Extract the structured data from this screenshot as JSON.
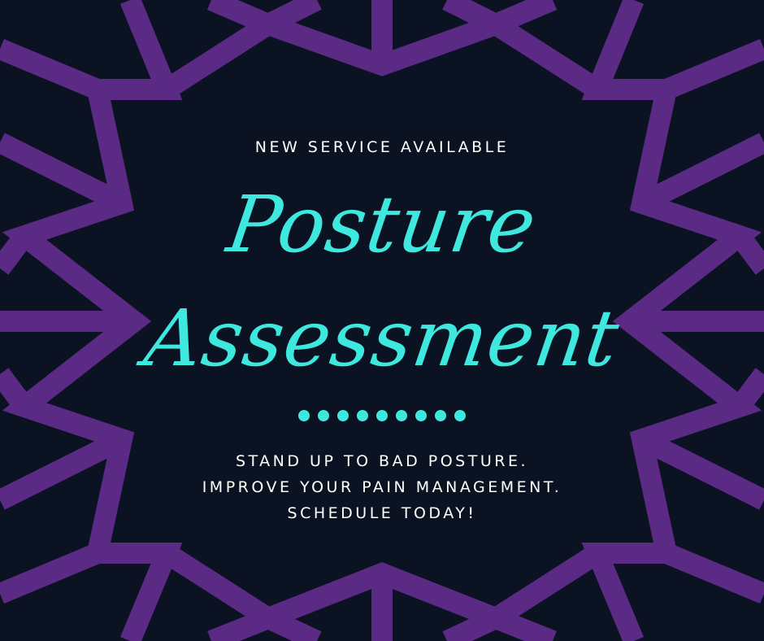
{
  "colors": {
    "background": "#0b1222",
    "ornament": "#5a2a85",
    "accent": "#3ee8de",
    "text": "#ffffff"
  },
  "eyebrow": "NEW SERVICE AVAILABLE",
  "title": {
    "line1": "Posture",
    "line2": "Assessment"
  },
  "divider_icon": "dot-divider-icon",
  "body": {
    "line1": "STAND UP TO BAD POSTURE.",
    "line2": "IMPROVE YOUR PAIN MANAGEMENT.",
    "line3": "SCHEDULE TODAY!"
  }
}
